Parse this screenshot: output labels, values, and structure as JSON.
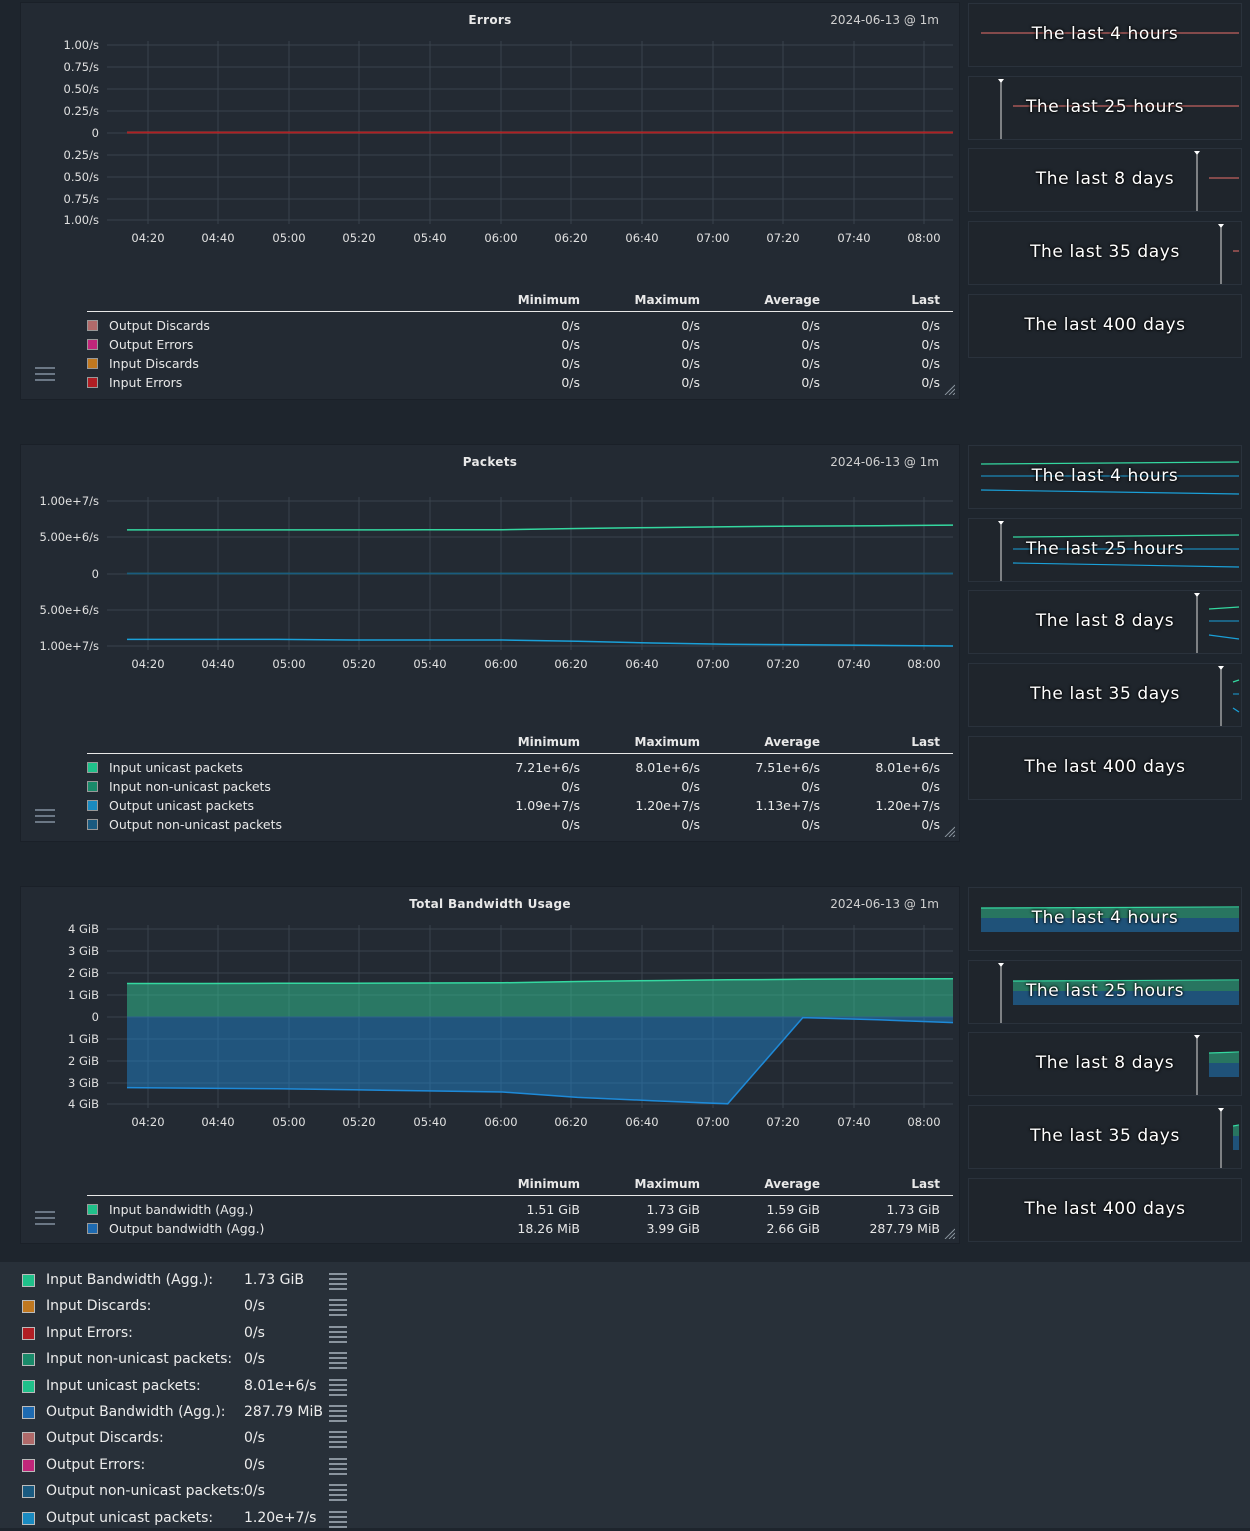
{
  "panels": [
    {
      "title": "Errors",
      "date": "2024-06-13 @ 1m",
      "yticks": [
        "1.00/s",
        "0.75/s",
        "0.50/s",
        "0.25/s",
        "0",
        "0.25/s",
        "0.50/s",
        "0.75/s",
        "1.00/s"
      ],
      "xticks": [
        "04:20",
        "04:40",
        "05:00",
        "05:20",
        "05:40",
        "06:00",
        "06:20",
        "06:40",
        "07:00",
        "07:20",
        "07:40",
        "08:00"
      ],
      "headers": {
        "min": "Minimum",
        "max": "Maximum",
        "avg": "Average",
        "last": "Last"
      },
      "rows": [
        {
          "name": "Output Discards",
          "color": "#b06a6a",
          "min": "0/s",
          "max": "0/s",
          "avg": "0/s",
          "last": "0/s"
        },
        {
          "name": "Output Errors",
          "color": "#c0267a",
          "min": "0/s",
          "max": "0/s",
          "avg": "0/s",
          "last": "0/s"
        },
        {
          "name": "Input Discards",
          "color": "#c07820",
          "min": "0/s",
          "max": "0/s",
          "avg": "0/s",
          "last": "0/s"
        },
        {
          "name": "Input Errors",
          "color": "#b01e24",
          "min": "0/s",
          "max": "0/s",
          "avg": "0/s",
          "last": "0/s"
        }
      ]
    },
    {
      "title": "Packets",
      "date": "2024-06-13 @ 1m",
      "yticks": [
        "1.00e+7/s",
        "5.00e+6/s",
        "0",
        "5.00e+6/s",
        "1.00e+7/s"
      ],
      "xticks": [
        "04:20",
        "04:40",
        "05:00",
        "05:20",
        "05:40",
        "06:00",
        "06:20",
        "06:40",
        "07:00",
        "07:20",
        "07:40",
        "08:00"
      ],
      "headers": {
        "min": "Minimum",
        "max": "Maximum",
        "avg": "Average",
        "last": "Last"
      },
      "rows": [
        {
          "name": "Input unicast packets",
          "color": "#20c08a",
          "min": "7.21e+6/s",
          "max": "8.01e+6/s",
          "avg": "7.51e+6/s",
          "last": "8.01e+6/s"
        },
        {
          "name": "Input non-unicast packets",
          "color": "#1a8a6a",
          "min": "0/s",
          "max": "0/s",
          "avg": "0/s",
          "last": "0/s"
        },
        {
          "name": "Output unicast packets",
          "color": "#1a8ac0",
          "min": "1.09e+7/s",
          "max": "1.20e+7/s",
          "avg": "1.13e+7/s",
          "last": "1.20e+7/s"
        },
        {
          "name": "Output non-unicast packets",
          "color": "#1a5a80",
          "min": "0/s",
          "max": "0/s",
          "avg": "0/s",
          "last": "0/s"
        }
      ]
    },
    {
      "title": "Total Bandwidth Usage",
      "date": "2024-06-13 @ 1m",
      "yticks": [
        "4 GiB",
        "3 GiB",
        "2 GiB",
        "1 GiB",
        "0",
        "1 GiB",
        "2 GiB",
        "3 GiB",
        "4 GiB"
      ],
      "xticks": [
        "04:20",
        "04:40",
        "05:00",
        "05:20",
        "05:40",
        "06:00",
        "06:20",
        "06:40",
        "07:00",
        "07:20",
        "07:40",
        "08:00"
      ],
      "headers": {
        "min": "Minimum",
        "max": "Maximum",
        "avg": "Average",
        "last": "Last"
      },
      "rows": [
        {
          "name": "Input bandwidth (Agg.)",
          "color": "#20c08a",
          "min": "1.51 GiB",
          "max": "1.73 GiB",
          "avg": "1.59 GiB",
          "last": "1.73 GiB"
        },
        {
          "name": "Output bandwidth (Agg.)",
          "color": "#1e6ab0",
          "min": "18.26 MiB",
          "max": "3.99 GiB",
          "avg": "2.66 GiB",
          "last": "287.79 MiB"
        }
      ]
    }
  ],
  "thumbs": [
    "The last 4 hours",
    "The last 25 hours",
    "The last 8 days",
    "The last 35 days",
    "The last 400 days"
  ],
  "legend": [
    {
      "name": "Input Bandwidth (Agg.):",
      "value": "1.73 GiB",
      "color": "#20c08a"
    },
    {
      "name": "Input Discards:",
      "value": "0/s",
      "color": "#c07820"
    },
    {
      "name": "Input Errors:",
      "value": "0/s",
      "color": "#b01e24"
    },
    {
      "name": "Input non-unicast packets:",
      "value": "0/s",
      "color": "#1a8a6a"
    },
    {
      "name": "Input unicast packets:",
      "value": "8.01e+6/s",
      "color": "#20c08a"
    },
    {
      "name": "Output Bandwidth (Agg.):",
      "value": "287.79 MiB",
      "color": "#1e6ab0"
    },
    {
      "name": "Output Discards:",
      "value": "0/s",
      "color": "#b06a6a"
    },
    {
      "name": "Output Errors:",
      "value": "0/s",
      "color": "#c0267a"
    },
    {
      "name": "Output non-unicast packets:",
      "value": "0/s",
      "color": "#1a5a80"
    },
    {
      "name": "Output unicast packets:",
      "value": "1.20e+7/s",
      "color": "#1a8ac0"
    }
  ],
  "chart_data": [
    {
      "type": "line",
      "title": "Errors",
      "x": [
        "04:20",
        "04:40",
        "05:00",
        "05:20",
        "05:40",
        "06:00",
        "06:20",
        "06:40",
        "07:00",
        "07:20",
        "07:40",
        "08:00"
      ],
      "ylim": [
        -1,
        1
      ],
      "series": [
        {
          "name": "Output Discards",
          "values": [
            0,
            0,
            0,
            0,
            0,
            0,
            0,
            0,
            0,
            0,
            0,
            0
          ]
        },
        {
          "name": "Output Errors",
          "values": [
            0,
            0,
            0,
            0,
            0,
            0,
            0,
            0,
            0,
            0,
            0,
            0
          ]
        },
        {
          "name": "Input Discards",
          "values": [
            0,
            0,
            0,
            0,
            0,
            0,
            0,
            0,
            0,
            0,
            0,
            0
          ]
        },
        {
          "name": "Input Errors",
          "values": [
            0,
            0,
            0,
            0,
            0,
            0,
            0,
            0,
            0,
            0,
            0,
            0
          ]
        }
      ]
    },
    {
      "type": "line",
      "title": "Packets",
      "x": [
        "04:20",
        "04:40",
        "05:00",
        "05:20",
        "05:40",
        "06:00",
        "06:20",
        "06:40",
        "07:00",
        "07:20",
        "07:40",
        "08:00"
      ],
      "ylim": [
        -12000000.0,
        12000000.0
      ],
      "series": [
        {
          "name": "Input unicast packets",
          "values": [
            7210000.0,
            7210000.0,
            7220000.0,
            7220000.0,
            7230000.0,
            7250000.0,
            7450000.0,
            7600000.0,
            7750000.0,
            7850000.0,
            7920000.0,
            8010000.0
          ]
        },
        {
          "name": "Input non-unicast packets",
          "values": [
            0,
            0,
            0,
            0,
            0,
            0,
            0,
            0,
            0,
            0,
            0,
            0
          ]
        },
        {
          "name": "Output unicast packets",
          "values": [
            -10900000.0,
            -10900000.0,
            -10900000.0,
            -11000000.0,
            -11000000.0,
            -11000000.0,
            -11200000.0,
            -11500000.0,
            -11700000.0,
            -11800000.0,
            -11900000.0,
            -12000000.0
          ]
        },
        {
          "name": "Output non-unicast packets",
          "values": [
            0,
            0,
            0,
            0,
            0,
            0,
            0,
            0,
            0,
            0,
            0,
            0
          ]
        }
      ]
    },
    {
      "type": "area",
      "title": "Total Bandwidth Usage",
      "x": [
        "04:20",
        "04:40",
        "05:00",
        "05:20",
        "05:40",
        "06:00",
        "06:20",
        "06:40",
        "07:00",
        "07:20",
        "07:40",
        "08:00"
      ],
      "ylim": [
        -4,
        4
      ],
      "series": [
        {
          "name": "Input bandwidth (Agg.)",
          "values": [
            1.51,
            1.51,
            1.52,
            1.52,
            1.53,
            1.54,
            1.6,
            1.64,
            1.68,
            1.7,
            1.72,
            1.73
          ]
        },
        {
          "name": "Output bandwidth (Agg.)",
          "values": [
            -3.25,
            -3.28,
            -3.3,
            -3.35,
            -3.4,
            -3.45,
            -3.7,
            -3.85,
            -3.99,
            -0.05,
            -0.15,
            -0.28
          ]
        }
      ]
    }
  ]
}
